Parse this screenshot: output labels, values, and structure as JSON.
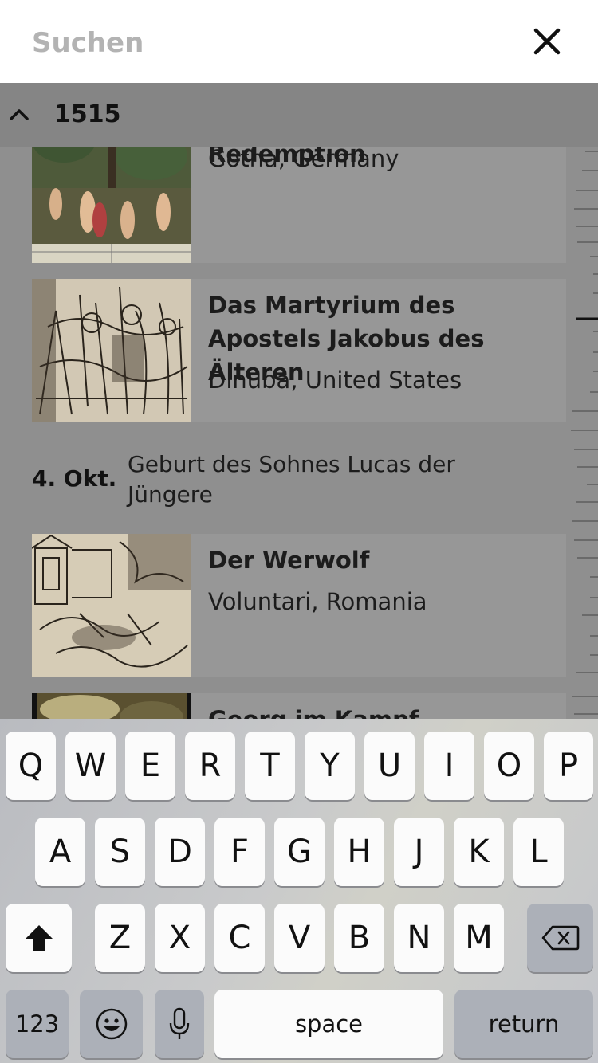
{
  "search": {
    "placeholder": "Suchen",
    "value": ""
  },
  "year_header": {
    "label": "1515"
  },
  "cards": [
    {
      "title": "Damnation and Redemption",
      "place": "Gotha, Germany"
    },
    {
      "title": "Das Martyrium des Apostels Jakobus des Älteren",
      "place": "Dinuba, United States"
    },
    {
      "title": "Der Werwolf",
      "place": "Voluntari, Romania"
    },
    {
      "title": "Georg im Kampf",
      "place": ""
    }
  ],
  "event": {
    "date": "4. Okt.",
    "text": "Geburt des Sohnes Lucas der Jüngere"
  },
  "keyboard": {
    "row1": [
      "Q",
      "W",
      "E",
      "R",
      "T",
      "Y",
      "U",
      "I",
      "O",
      "P"
    ],
    "row2": [
      "A",
      "S",
      "D",
      "F",
      "G",
      "H",
      "J",
      "K",
      "L"
    ],
    "row3": [
      "Z",
      "X",
      "C",
      "V",
      "B",
      "N",
      "M"
    ],
    "numbers_label": "123",
    "space_label": "space",
    "return_label": "return"
  },
  "colors": {
    "header_bg": "#ffffff",
    "overlay": "#8f8f8f",
    "key_bg": "#fbfbfb",
    "key_dark": "#acb0b8"
  }
}
